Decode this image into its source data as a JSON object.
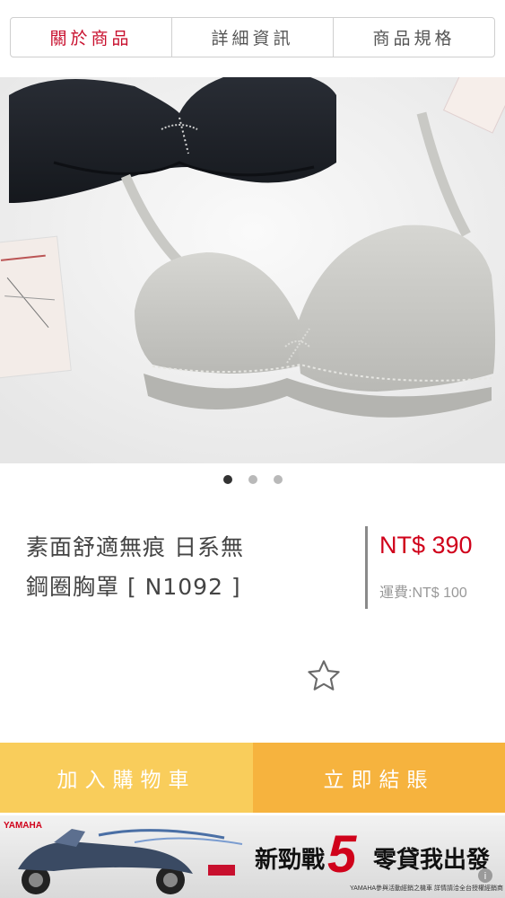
{
  "tabs": [
    {
      "label": "關於商品",
      "active": true
    },
    {
      "label": "詳細資訊",
      "active": false
    },
    {
      "label": "商品規格",
      "active": false
    }
  ],
  "carousel": {
    "count": 3,
    "active_index": 0
  },
  "product": {
    "title_line1": "素面舒適無痕 日系無",
    "title_line2": "鋼圈胸罩 [ N1092 ]",
    "price": "NT$ 390",
    "shipping": "運費:NT$ 100"
  },
  "favorite_icon": "star-outline-icon",
  "actions": {
    "add_to_cart": "加入購物車",
    "checkout": "立即結賬"
  },
  "ad": {
    "brand": "YAMAHA",
    "slogan_a": "新勁戰",
    "number": "5",
    "slogan_b": "零貸我出發",
    "fine_print": "YAMAHA參與活動經銷之機車 詳情請洽全台授權經銷商"
  },
  "colors": {
    "accent_red": "#c8102e",
    "price_red": "#d0021b",
    "cart_button": "#f9cd5b",
    "checkout_button": "#f6b33e"
  }
}
